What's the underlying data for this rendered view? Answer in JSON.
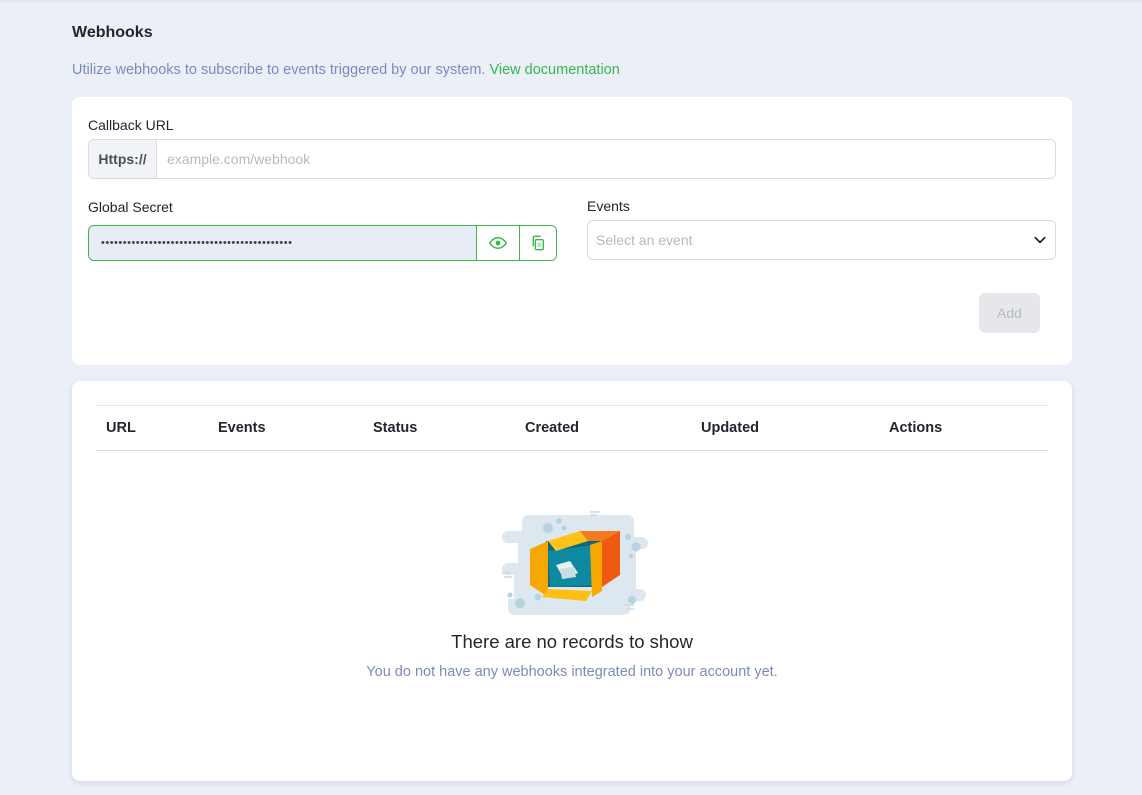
{
  "header": {
    "title": "Webhooks",
    "subtitle": "Utilize webhooks to subscribe to events triggered by our system.",
    "doc_link": "View documentation"
  },
  "form": {
    "callback_label": "Callback URL",
    "url_prefix": "Https://",
    "url_placeholder": "example.com/webhook",
    "secret_label": "Global Secret",
    "secret_value": "••••••••••••••••••••••••••••••••••••••••••••",
    "events_label": "Events",
    "events_placeholder": "Select an event",
    "add_label": "Add"
  },
  "table": {
    "columns": [
      "URL",
      "Events",
      "Status",
      "Created",
      "Updated",
      "Actions"
    ],
    "empty_title": "There are no records to show",
    "empty_desc": "You do not have any webhooks integrated into your account yet."
  },
  "colors": {
    "accent": "#3bb54a",
    "muted_text": "#7c8bb8",
    "background": "#eaeff8"
  }
}
